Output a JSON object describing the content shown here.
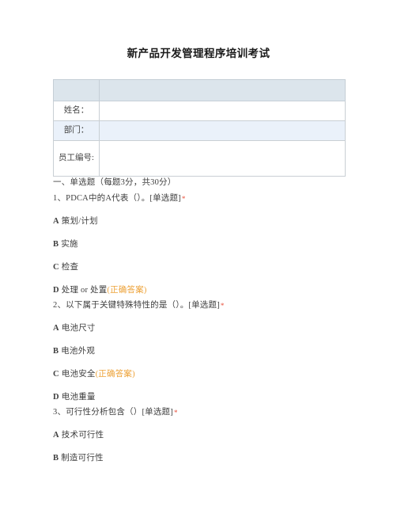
{
  "document": {
    "title": "新产品开发管理程序培训考试"
  },
  "info_table": {
    "header_row": {
      "label": "",
      "value": ""
    },
    "rows": [
      {
        "label": "姓名：",
        "value": ""
      },
      {
        "label": "部门：",
        "value": ""
      },
      {
        "label": "员工编号:",
        "value": ""
      }
    ]
  },
  "sections": [
    {
      "heading": "一、单选题（每题3分，共30分）",
      "questions": [
        {
          "text": "1、PDCA中的A代表（）。[单选题]",
          "required_mark": "*",
          "options": [
            {
              "letter": "A",
              "text": "策划/计划",
              "answer_tag": ""
            },
            {
              "letter": "B",
              "text": "实施",
              "answer_tag": ""
            },
            {
              "letter": "C",
              "text": "检查",
              "answer_tag": ""
            },
            {
              "letter": "D",
              "text": "处理 or 处置",
              "answer_tag": "(正确答案)"
            }
          ]
        },
        {
          "text": "2、以下属于关键特殊特性的是（）。[单选题]",
          "required_mark": "*",
          "options": [
            {
              "letter": "A",
              "text": "电池尺寸",
              "answer_tag": ""
            },
            {
              "letter": "B",
              "text": "电池外观",
              "answer_tag": ""
            },
            {
              "letter": "C",
              "text": "电池安全",
              "answer_tag": "(正确答案)"
            },
            {
              "letter": "D",
              "text": "电池重量",
              "answer_tag": ""
            }
          ]
        },
        {
          "text": "3、可行性分析包含（）[单选题]",
          "required_mark": "*",
          "options": [
            {
              "letter": "A",
              "text": "技术可行性",
              "answer_tag": ""
            },
            {
              "letter": "B",
              "text": "制造可行性",
              "answer_tag": ""
            }
          ]
        }
      ]
    }
  ],
  "colors": {
    "table_header_bg": "#dce5ec",
    "table_alt_row_bg": "#eaf1fa",
    "table_border": "#c9cfd4",
    "required_mark": "#e8503c",
    "answer_tag": "#eda238",
    "text": "#3f3f3f"
  }
}
